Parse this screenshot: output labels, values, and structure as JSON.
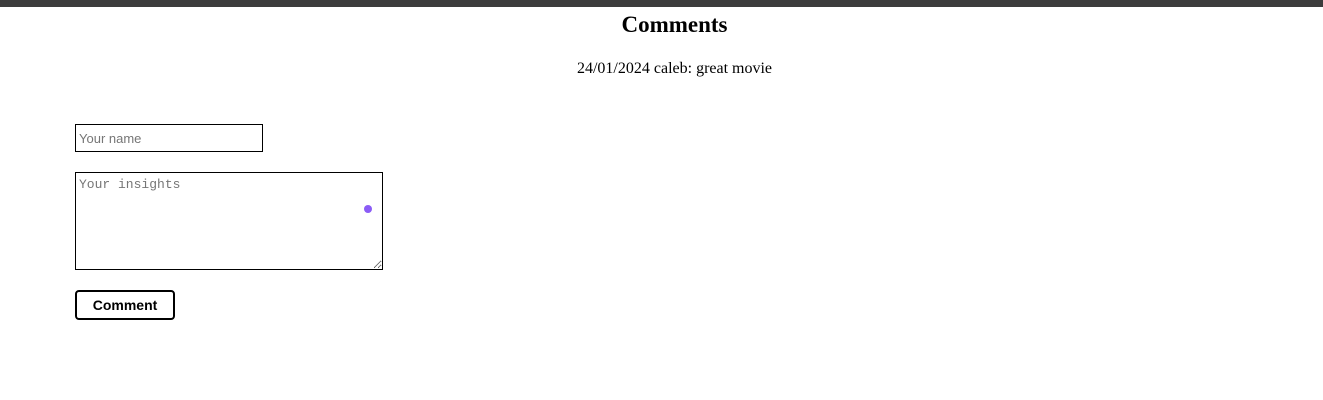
{
  "page": {
    "title": "Comments"
  },
  "comments": [
    {
      "date": "24/01/2024",
      "author": "caleb:",
      "text": "great movie"
    }
  ],
  "form": {
    "name_placeholder": "Your name",
    "name_value": "",
    "insights_placeholder": "Your insights",
    "insights_value": "",
    "submit_label": "Comment"
  },
  "colors": {
    "top_bar": "#3c3c3c",
    "status_dot": "#8b5cf6"
  }
}
